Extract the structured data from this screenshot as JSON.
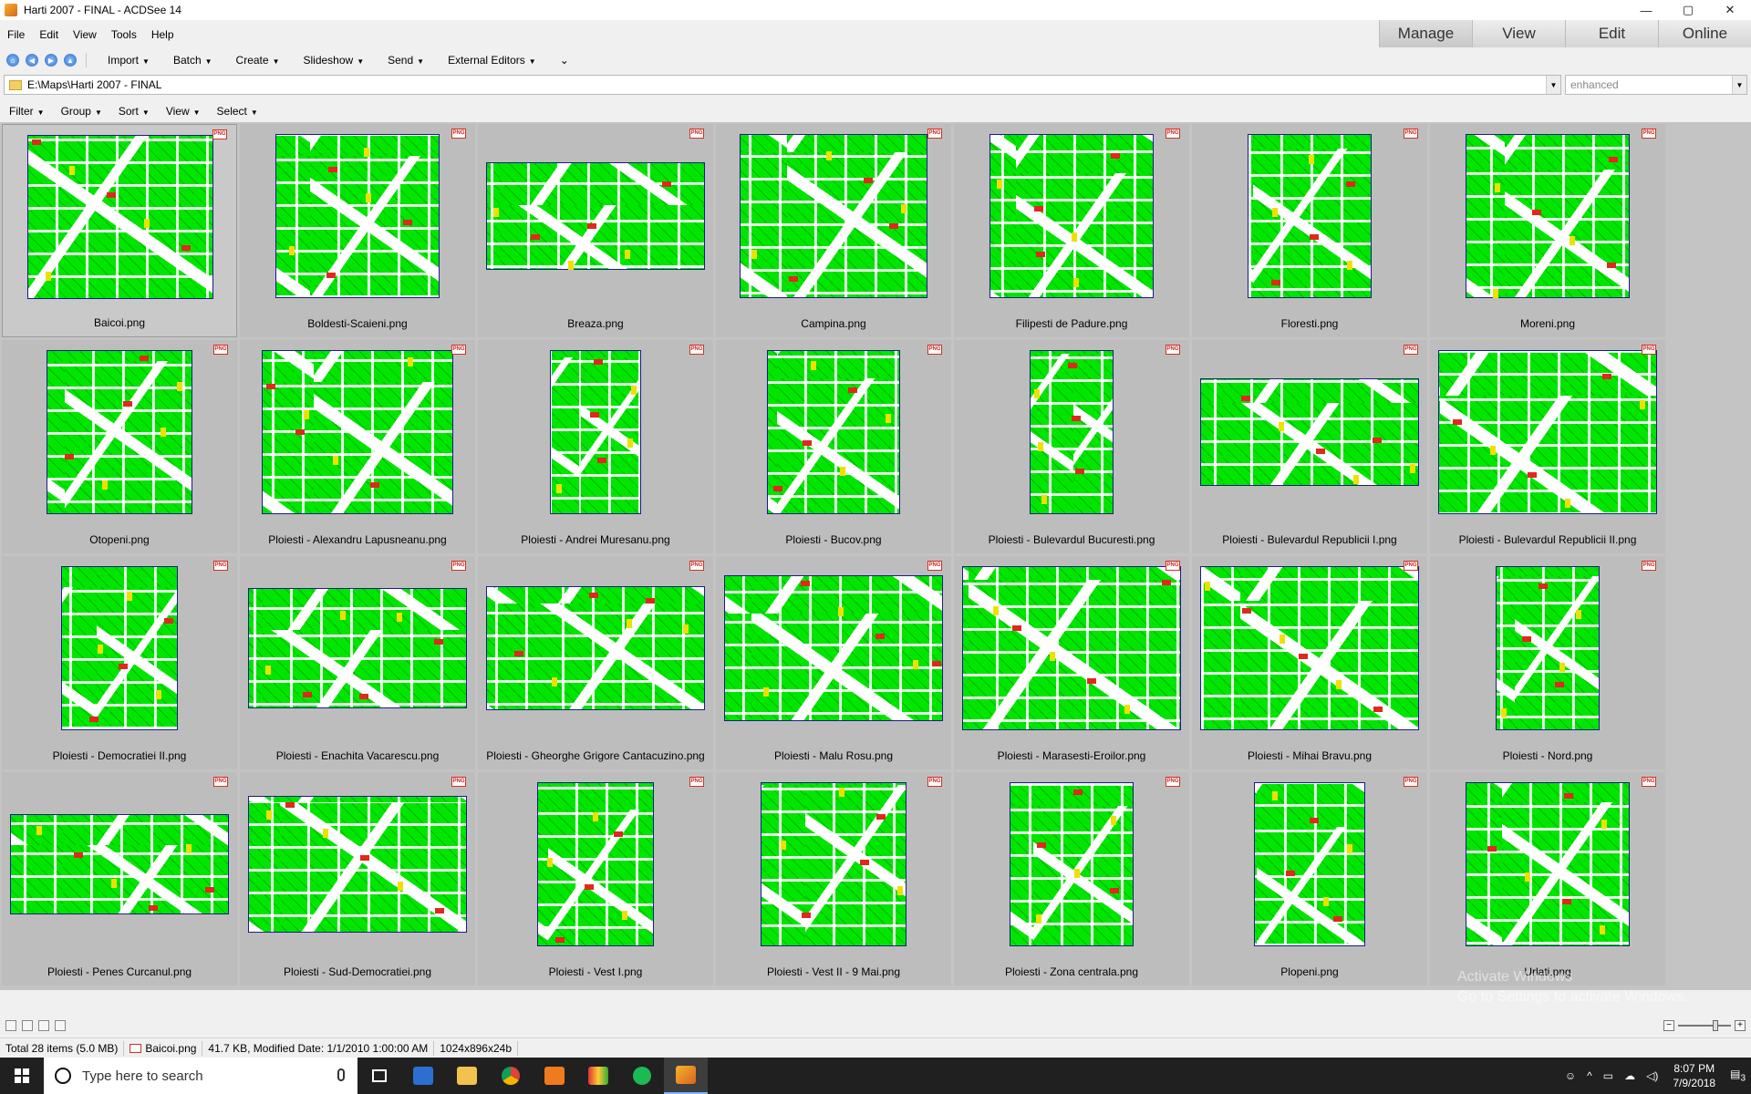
{
  "window": {
    "title": "Harti 2007 - FINAL - ACDSee 14",
    "controls": {
      "minimize": "—",
      "maximize": "▢",
      "close": "✕"
    }
  },
  "menu": [
    "File",
    "Edit",
    "View",
    "Tools",
    "Help"
  ],
  "modes": [
    "Manage",
    "View",
    "Edit",
    "Online"
  ],
  "toolbar": {
    "items": [
      "Import",
      "Batch",
      "Create",
      "Slideshow",
      "Send",
      "External Editors"
    ]
  },
  "address": {
    "path": "E:\\Maps\\Harti 2007 - FINAL",
    "filter_placeholder": "enhanced"
  },
  "filterbar": [
    "Filter",
    "Group",
    "Sort",
    "View",
    "Select"
  ],
  "badge": "PNG",
  "files": [
    "Baicoi.png",
    "Boldesti-Scaieni.png",
    "Breaza.png",
    "Campina.png",
    "Filipesti de Padure.png",
    "Floresti.png",
    "Moreni.png",
    "Otopeni.png",
    "Ploiesti - Alexandru Lapusneanu.png",
    "Ploiesti - Andrei Muresanu.png",
    "Ploiesti - Bucov.png",
    "Ploiesti - Bulevardul Bucuresti.png",
    "Ploiesti - Bulevardul Republicii I.png",
    "Ploiesti - Bulevardul Republicii II.png",
    "Ploiesti - Democratiei II.png",
    "Ploiesti - Enachita Vacarescu.png",
    "Ploiesti - Gheorghe Grigore Cantacuzino.png",
    "Ploiesti - Malu Rosu.png",
    "Ploiesti - Marasesti-Eroilor.png",
    "Ploiesti - Mihai Bravu.png",
    "Ploiesti - Nord.png",
    "Ploiesti - Penes Curcanul.png",
    "Ploiesti - Sud-Democratiei.png",
    "Ploiesti - Vest I.png",
    "Ploiesti - Vest II - 9 Mai.png",
    "Ploiesti - Zona centrala.png",
    "Plopeni.png",
    "Urlati.png"
  ],
  "status": {
    "total": "Total 28 items  (5.0 MB)",
    "current_file": "Baicoi.png",
    "details": "41.7 KB, Modified Date: 1/1/2010 1:00:00 AM",
    "dimensions": "1024x896x24b"
  },
  "watermark": {
    "line1": "Activate Windows",
    "line2": "Go to Settings to activate Windows."
  },
  "taskbar": {
    "search_placeholder": "Type here to search",
    "time": "8:07 PM",
    "date": "7/9/2018",
    "notifications": "3"
  }
}
